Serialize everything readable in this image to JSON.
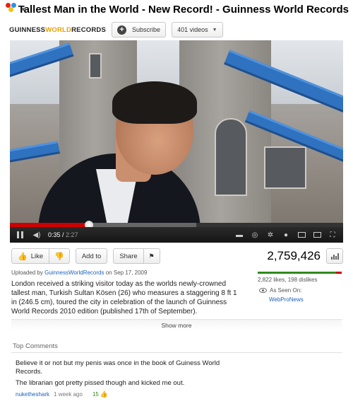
{
  "header": {
    "title": "Tallest Man in the World - New Record! - Guinness World Records",
    "logo_icon": "youtube-logo-icon"
  },
  "channel": {
    "name_part1": "GUINNESS",
    "name_part2": "WORLD",
    "name_part3": "RECORDS",
    "subscribe_label": "Subscribe",
    "videos_label": "401 videos"
  },
  "player": {
    "current_time": "0:35",
    "duration": "2:27",
    "progress_fraction": 0.238,
    "buffered_fraction": 0.56
  },
  "actions": {
    "like_label": "Like",
    "add_to_label": "Add to",
    "share_label": "Share",
    "view_count": "2,759,426"
  },
  "info": {
    "uploaded_prefix": "Uploaded by",
    "uploader": "GuinnessWorldRecords",
    "uploaded_date": "on Sep 17, 2009",
    "description": "London received a striking visitor today as the worlds newly-crowned tallest man, Turkish Sultan Kösen (26) who measures a staggering 8 ft 1 in (246.5 cm), toured the city in celebration of the launch of Guinness World Records 2010 edition (published 17th of September).",
    "likes_text": "2,822 likes, 198 dislikes",
    "likes": 2822,
    "dislikes": 198,
    "seen_on_label": "As Seen On:",
    "seen_on_site": "WebProNews",
    "show_more_label": "Show more"
  },
  "comments": {
    "header": "Top Comments",
    "items": [
      {
        "line1": "Believe it or not but my penis was once in the book of Guiness World Records.",
        "line2": "The librarian got pretty pissed though and kicked me out.",
        "author": "nuketheshark",
        "age": "1 week ago",
        "rating": "15"
      }
    ]
  },
  "colors": {
    "accent_red": "#cc0000",
    "link_blue": "#1c62b9",
    "like_green": "#2e8a1c"
  }
}
